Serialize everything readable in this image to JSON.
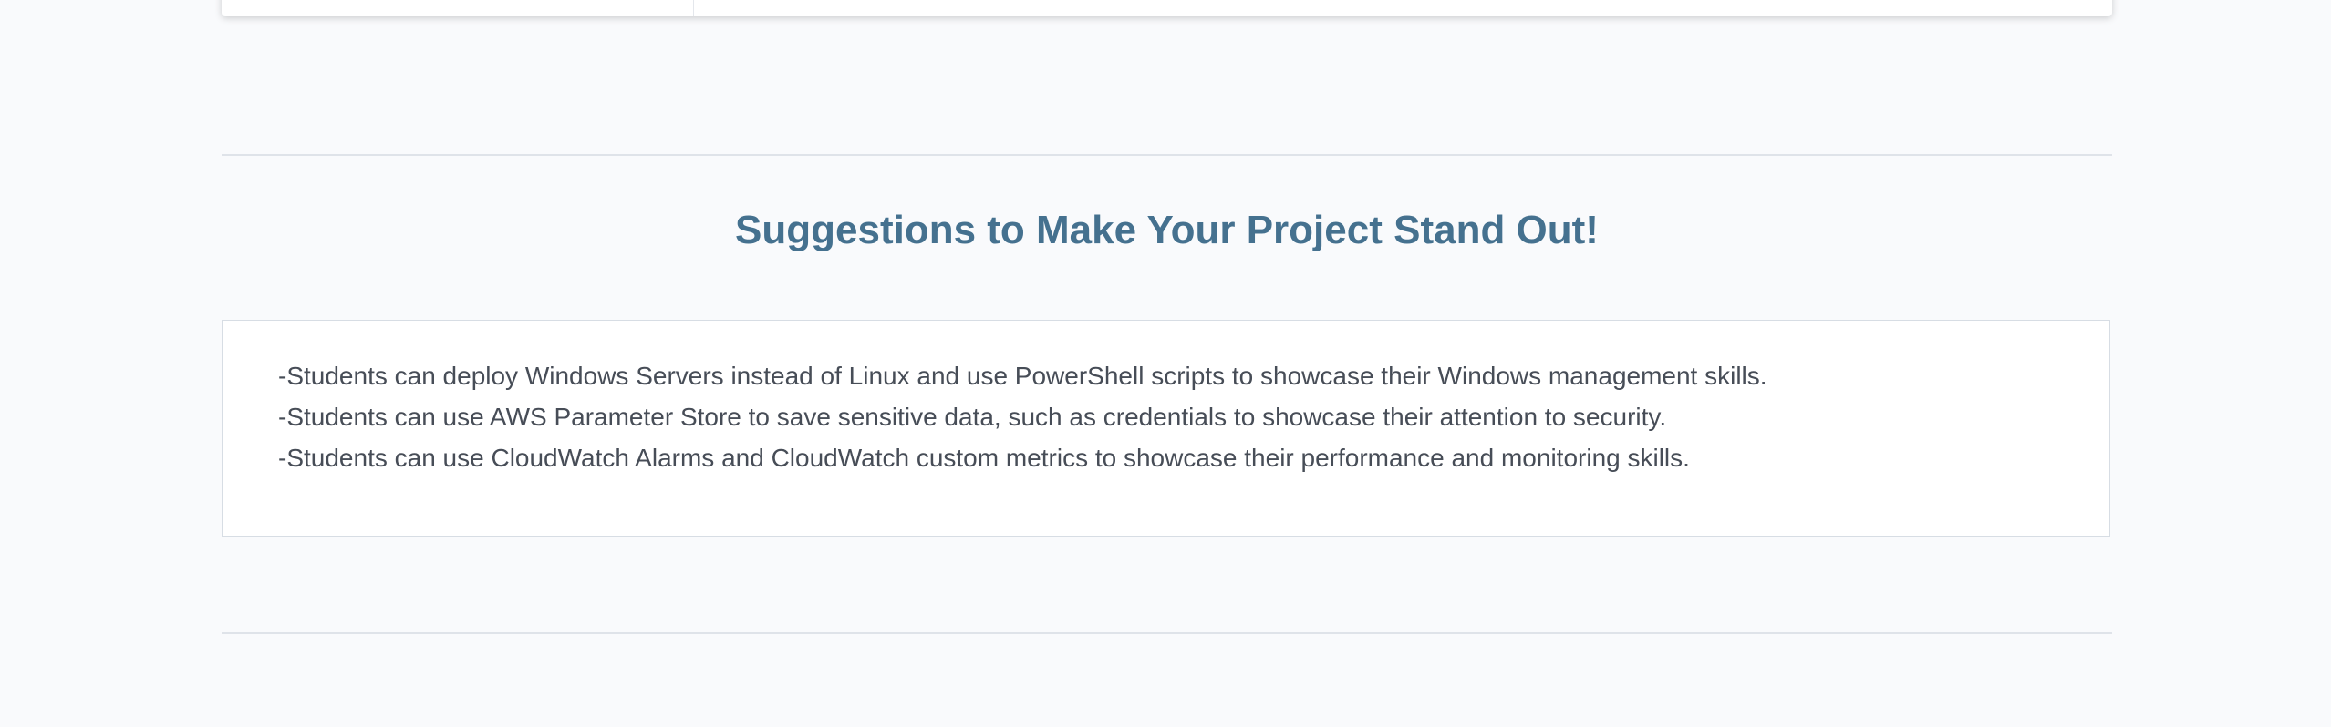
{
  "section": {
    "title": "Suggestions to Make Your Project Stand Out!",
    "suggestions": [
      "-Students can deploy Windows Servers instead of Linux and use PowerShell scripts to showcase their Windows management skills.",
      "-Students can use AWS Parameter Store to save sensitive data, such as credentials to showcase their attention to security.",
      "-Students can use CloudWatch Alarms and CloudWatch custom metrics to showcase their performance and monitoring skills."
    ]
  },
  "colors": {
    "page_background": "#f9fafc",
    "title": "#45718f",
    "body_text": "#474d57",
    "border": "#d7dde4"
  }
}
